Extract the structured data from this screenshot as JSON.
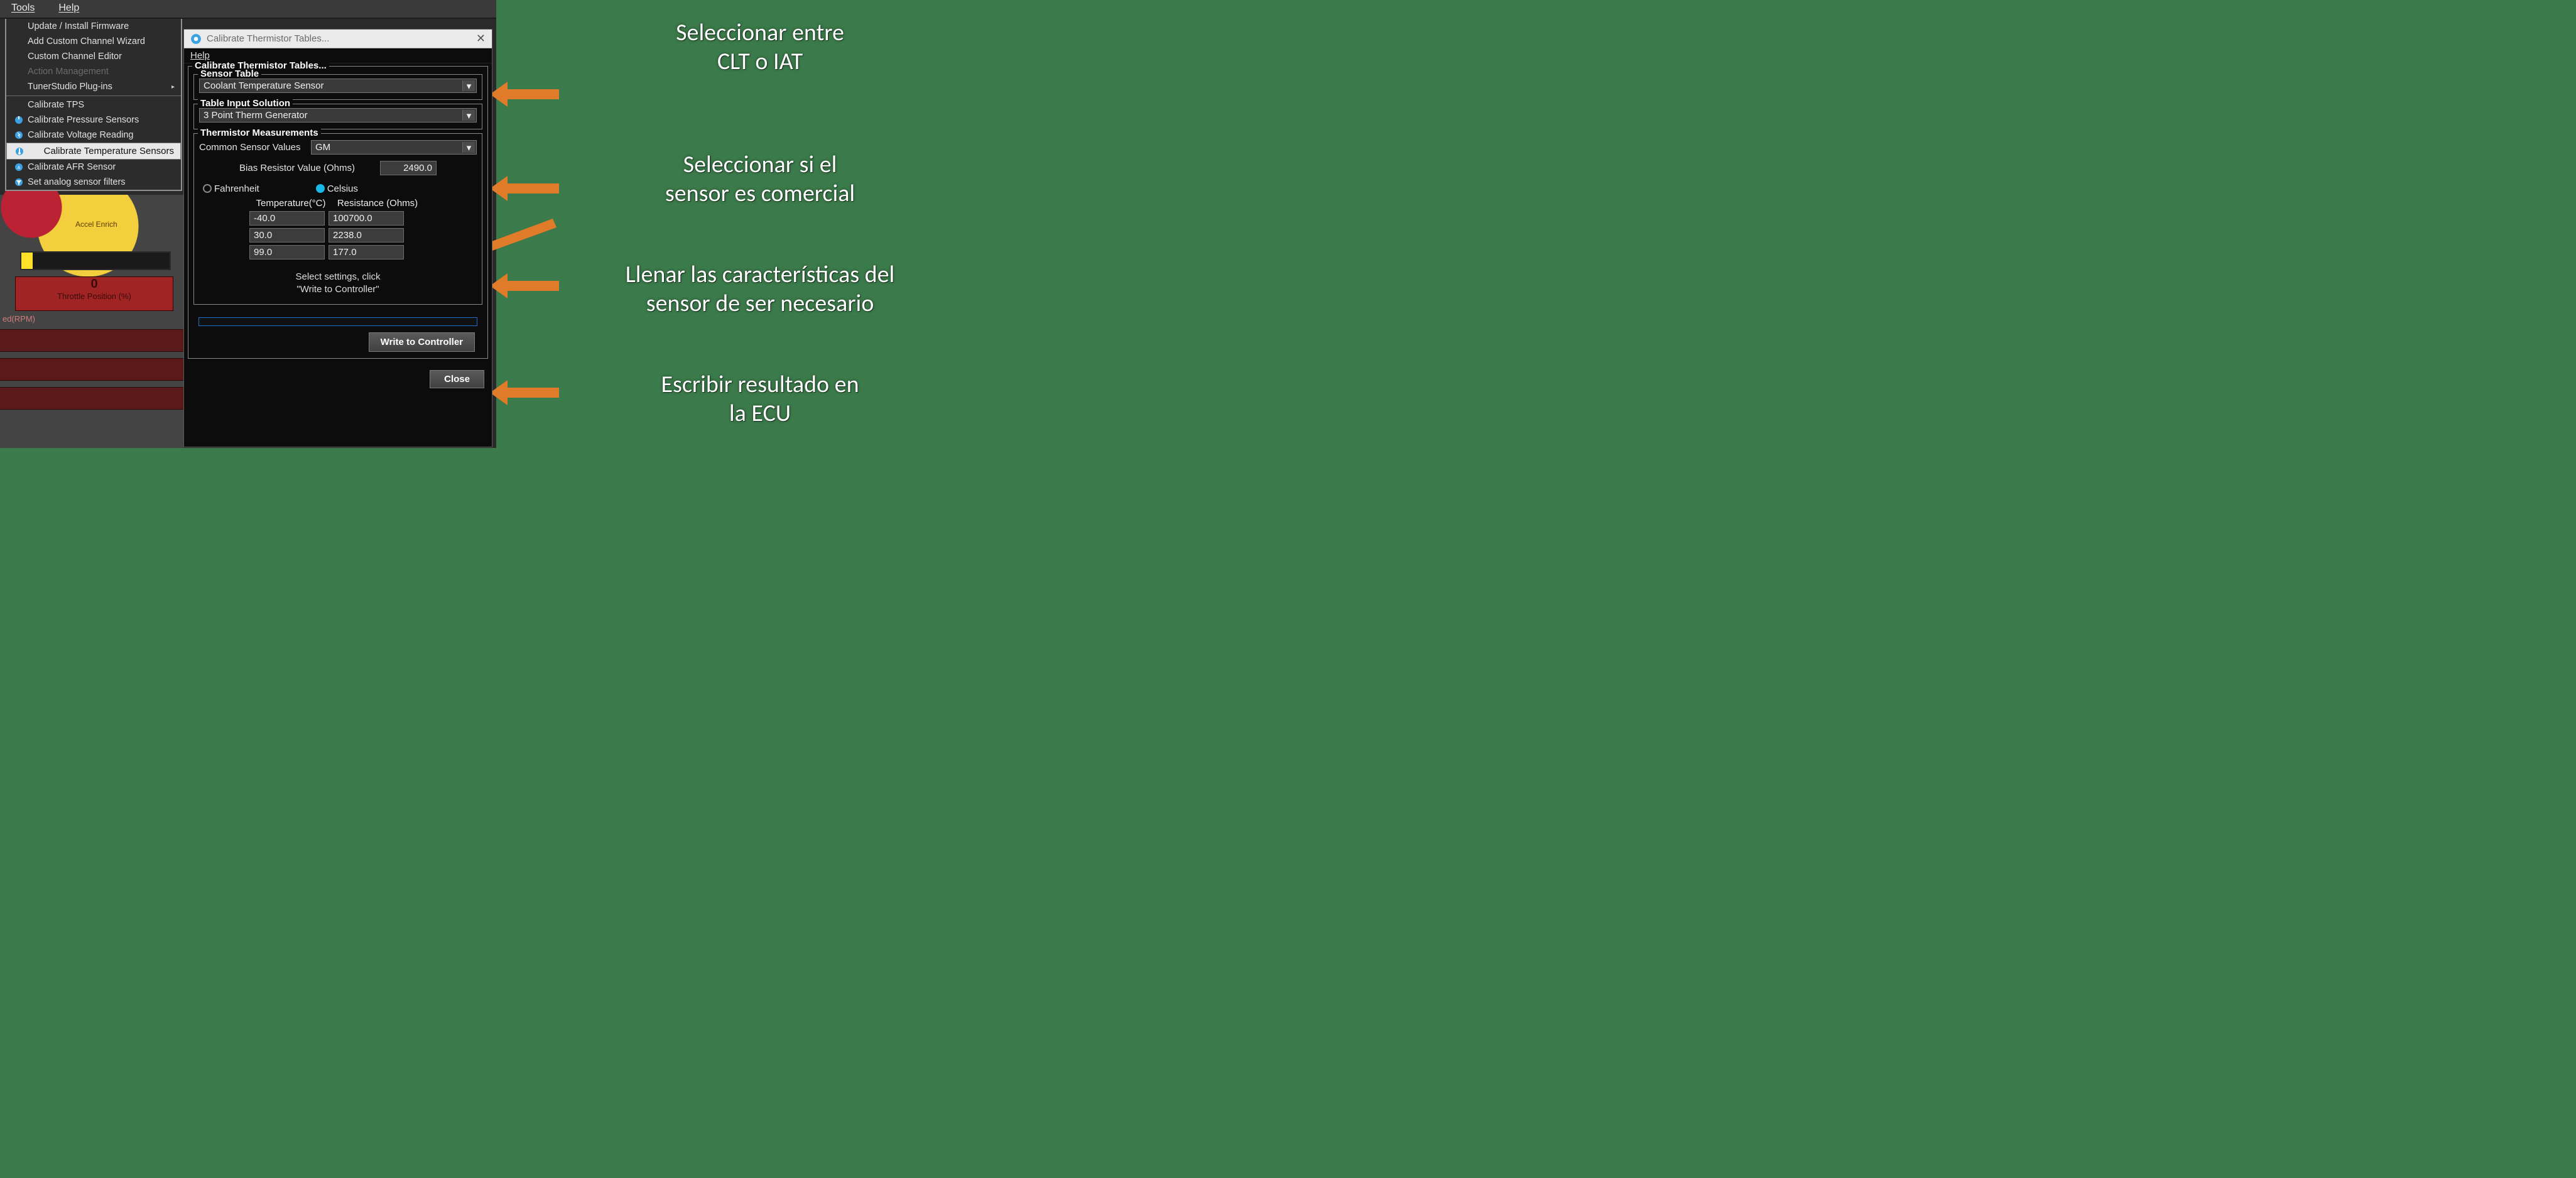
{
  "menubar": {
    "tools": "Tools",
    "help": "Help"
  },
  "tools_menu": {
    "update": "Update / Install Firmware",
    "add_wiz": "Add Custom Channel Wizard",
    "cc_editor": "Custom Channel Editor",
    "action_mgmt": "Action Management",
    "plugins": "TunerStudio Plug-ins",
    "cal_tps": "Calibrate TPS",
    "cal_press": "Calibrate Pressure Sensors",
    "cal_volt": "Calibrate Voltage Reading",
    "cal_temp": "Calibrate Temperature Sensors",
    "cal_afr": "Calibrate AFR Sensor",
    "set_analog": "Set analog sensor filters"
  },
  "dialog": {
    "title": "Calibrate Thermistor Tables...",
    "help": "Help",
    "main_legend": "Calibrate Thermistor Tables...",
    "sensor_table": {
      "legend": "Sensor Table",
      "value": "Coolant Temperature Sensor"
    },
    "table_input": {
      "legend": "Table Input Solution",
      "value": "3 Point Therm Generator"
    },
    "therm": {
      "legend": "Thermistor Measurements",
      "common_label": "Common Sensor Values",
      "common_value": "GM",
      "bias_label": "Bias Resistor Value (Ohms)",
      "bias_value": "2490.0",
      "fahrenheit": "Fahrenheit",
      "celsius": "Celsius",
      "col_temp": "Temperature(°C)",
      "col_res": "Resistance (Ohms)",
      "rows": [
        {
          "t": "-40.0",
          "r": "100700.0"
        },
        {
          "t": "30.0",
          "r": "2238.0"
        },
        {
          "t": "99.0",
          "r": "177.0"
        }
      ],
      "hint1": "Select settings, click",
      "hint2": "\"Write to Controller\""
    },
    "write_btn": "Write to Controller",
    "close_btn": "Close"
  },
  "bg": {
    "accel": "Accel Enrich",
    "zero": "0",
    "tp": "Throttle Position (%)",
    "rpm": "ed(RPM)"
  },
  "annotations": {
    "a1": "Seleccionar entre\nCLT o IAT",
    "a2": "Seleccionar si el\nsensor es comercial",
    "a3": "Llenar las características del\nsensor de ser necesario",
    "a4": "Escribir resultado en\nla ECU"
  }
}
